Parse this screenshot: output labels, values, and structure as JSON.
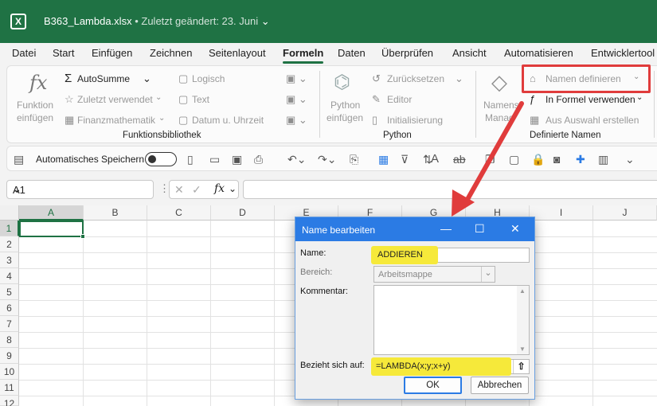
{
  "titlebar": {
    "filename": "B363_Lambda.xlsx",
    "separator": "•",
    "modified": "Zuletzt geändert: 23. Juni"
  },
  "tabs": [
    "Datei",
    "Start",
    "Einfügen",
    "Zeichnen",
    "Seitenlayout",
    "Formeln",
    "Daten",
    "Überprüfen",
    "Ansicht",
    "Automatisieren",
    "Entwicklertool"
  ],
  "ribbon": {
    "funktion_label1": "Funktion",
    "funktion_label2": "einfügen",
    "autosumme": "AutoSumme",
    "zuletzt": "Zuletzt verwendet",
    "finanz": "Finanzmathematik",
    "logisch": "Logisch",
    "text": "Text",
    "datum": "Datum u. Uhrzeit",
    "group_funktionsbibliothek": "Funktionsbibliothek",
    "python_label1": "Python",
    "python_label2": "einfügen",
    "zuruecksetzen": "Zurücksetzen",
    "editor": "Editor",
    "initialisierung": "Initialisierung",
    "group_python": "Python",
    "namens_label1": "Namens-",
    "namens_label2": "Manag",
    "namen_definieren": "Namen definieren",
    "in_formel": "In Formel verwenden",
    "aus_auswahl": "Aus Auswahl erstellen",
    "group_definierte_namen": "Definierte Namen"
  },
  "qat": {
    "autosave_label": "Automatisches Speichern"
  },
  "formula_bar": {
    "namebox": "A1",
    "fx": "fx",
    "formula": ""
  },
  "columns": [
    "A",
    "B",
    "C",
    "D",
    "E",
    "F",
    "G",
    "H",
    "I",
    "J"
  ],
  "rows": [
    "1",
    "2",
    "3",
    "4",
    "5",
    "6",
    "7",
    "8",
    "9",
    "10",
    "11",
    "12"
  ],
  "dialog": {
    "title": "Name bearbeiten",
    "name_label": "Name:",
    "name_value": "ADDIEREN",
    "bereich_label": "Bereich:",
    "bereich_value": "Arbeitsmappe",
    "kommentar_label": "Kommentar:",
    "bezieht_label": "Bezieht sich auf:",
    "bezieht_value": "=LAMBDA(x;y;x+y)",
    "ok": "OK",
    "abbrechen": "Abbrechen"
  },
  "colors": {
    "excel_green": "#1f7244",
    "dialog_blue": "#2b7be4",
    "highlight_yellow": "#f6e93a",
    "callout_red": "#e03c3c"
  }
}
